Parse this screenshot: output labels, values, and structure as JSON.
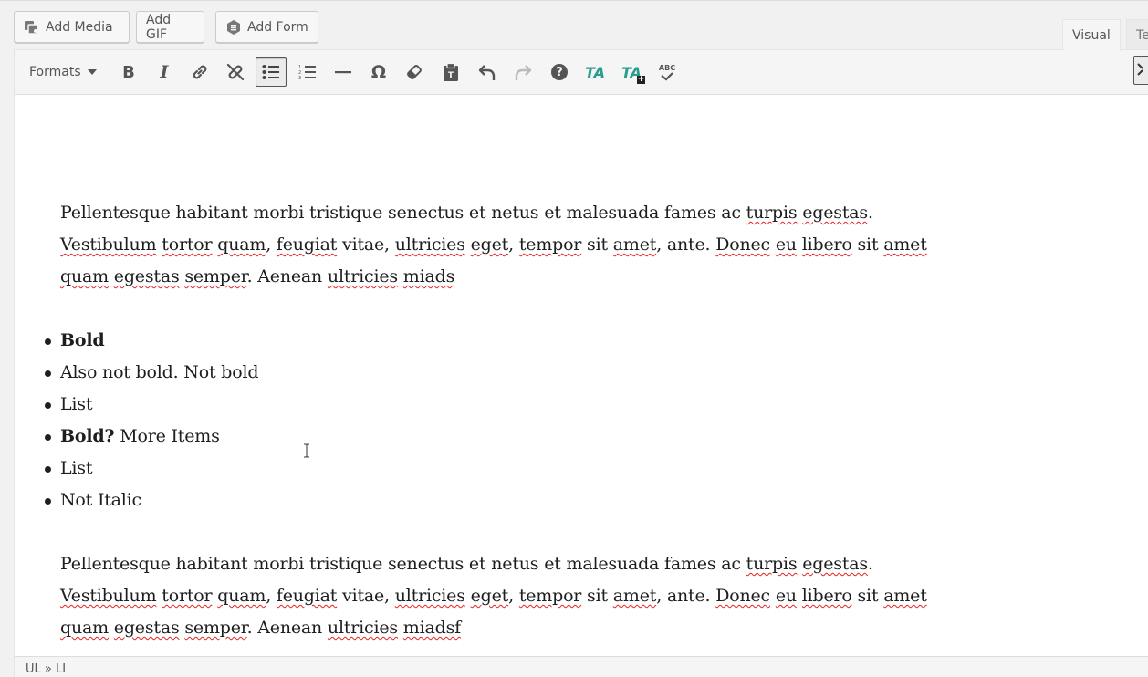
{
  "media_buttons": {
    "add_media": "Add Media",
    "add_gif": "Add GIF",
    "add_form": "Add Form"
  },
  "tabs": {
    "visual": "Visual",
    "text": "Te"
  },
  "toolbar": {
    "formats": "Formats",
    "buttons": [
      "bold-icon",
      "italic-icon",
      "link-icon",
      "unlink-icon",
      "bulleted-list-icon",
      "numbered-list-icon",
      "horizontal-line-icon",
      "special-character-icon",
      "clear-formatting-icon",
      "paste-as-text-icon",
      "undo-icon",
      "redo-icon",
      "help-icon",
      "tablepress-icon",
      "tablepress-add-icon",
      "spellcheck-icon"
    ],
    "spellcheck_label": "ABC",
    "ta_label": "TA",
    "omega": "Ω",
    "help": "?"
  },
  "content": {
    "paragraph1": {
      "line1": [
        "Pellentesque habitant morbi tristique senectus et netus et malesuada fames ac ",
        "turpis",
        " ",
        "egestas",
        "."
      ],
      "line2": [
        "Vestibulum",
        " ",
        "tortor",
        " ",
        "quam",
        ", ",
        "feugiat",
        " vitae, ",
        "ultricies",
        " ",
        "eget",
        ", ",
        "tempor",
        " sit ",
        "amet",
        ", ante. ",
        "Donec",
        " ",
        "eu",
        " ",
        "libero",
        " sit ",
        "amet"
      ],
      "line3": [
        "quam",
        " ",
        "egestas",
        " ",
        "semper",
        ". Aenean ",
        "ultricies",
        " ",
        "miads"
      ]
    },
    "list": [
      {
        "bold": "Bold",
        "rest": ""
      },
      {
        "bold": "",
        "rest": "Also not bold. Not bold"
      },
      {
        "bold": "",
        "rest": "List"
      },
      {
        "bold": "Bold?",
        "rest": " More Items"
      },
      {
        "bold": "",
        "rest": "List"
      },
      {
        "bold": "",
        "rest": "Not Italic"
      }
    ],
    "paragraph2": {
      "line1": [
        "Pellentesque habitant morbi tristique senectus et netus et malesuada fames ac ",
        "turpis",
        " ",
        "egestas",
        "."
      ],
      "line2": [
        "Vestibulum",
        " ",
        "tortor",
        " ",
        "quam",
        ", ",
        "feugiat",
        " vitae, ",
        "ultricies",
        " ",
        "eget",
        ", ",
        "tempor",
        " sit ",
        "amet",
        ", ante. ",
        "Donec",
        " ",
        "eu",
        " ",
        "libero",
        " sit ",
        "amet"
      ],
      "line3": [
        "quam",
        " ",
        "egestas",
        " ",
        "semper",
        ". Aenean ",
        "ultricies",
        " ",
        "miadsf"
      ]
    }
  },
  "statusbar": {
    "path": "UL » LI"
  },
  "colors": {
    "spell_underline": "#e62222",
    "tablepress_teal": "#2a9d8f"
  }
}
